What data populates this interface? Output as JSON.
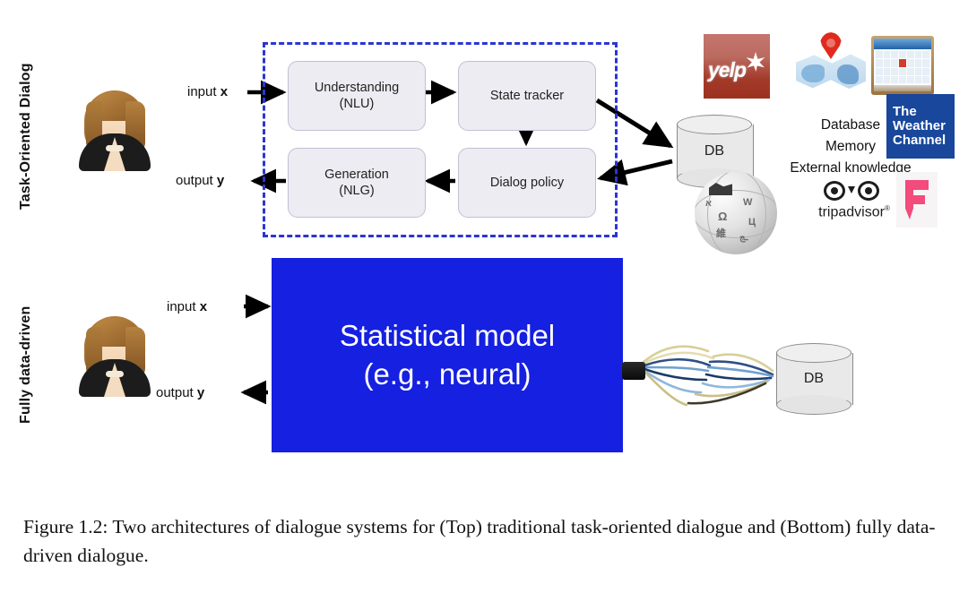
{
  "figure": {
    "caption": "Figure 1.2: Two architectures of dialogue systems for (Top) traditional task-oriented dialogue and (Bottom) fully data-driven dialogue."
  },
  "sections": {
    "top": {
      "label": "Task-Oriented Dialog",
      "input_label_prefix": "input ",
      "input_label_var": "x",
      "output_label_prefix": "output ",
      "output_label_var": "y",
      "pipeline": [
        {
          "id": "nlu",
          "line1": "Understanding",
          "line2": "(NLU)"
        },
        {
          "id": "state-tracker",
          "line1": "State tracker",
          "line2": ""
        },
        {
          "id": "nlg",
          "line1": "Generation",
          "line2": "(NLG)"
        },
        {
          "id": "dialog-policy",
          "line1": "Dialog policy",
          "line2": ""
        }
      ],
      "database_label": "DB",
      "knowledge_sources": [
        "Database",
        "Memory",
        "External knowledge"
      ],
      "logos": [
        {
          "name": "yelp-logo",
          "text": "yelp"
        },
        {
          "name": "map-pin-logo",
          "text": ""
        },
        {
          "name": "calendar-logo",
          "text": ""
        },
        {
          "name": "weather-channel-logo",
          "line1": "The",
          "line2": "Weather",
          "line3": "Channel"
        },
        {
          "name": "wikipedia-logo",
          "text": ""
        },
        {
          "name": "tripadvisor-logo",
          "text": "tripadvisor",
          "mark": "®"
        },
        {
          "name": "foursquare-logo",
          "text": ""
        }
      ]
    },
    "bottom": {
      "label": "Fully data-driven",
      "input_label_prefix": "input ",
      "input_label_var": "x",
      "output_label_prefix": "output ",
      "output_label_var": "y",
      "model_line1": "Statistical model",
      "model_line2": "(e.g., neural)",
      "database_label": "DB"
    }
  },
  "colors": {
    "dashed_border": "#2b36d0",
    "model_box": "#1520e0",
    "module_fill": "#edecf2",
    "module_border": "#c3bfd2",
    "yelp_red": "#a33a29",
    "weather_blue": "#18479c",
    "foursquare_pink": "#f24b7c",
    "arrow": "#000000"
  }
}
